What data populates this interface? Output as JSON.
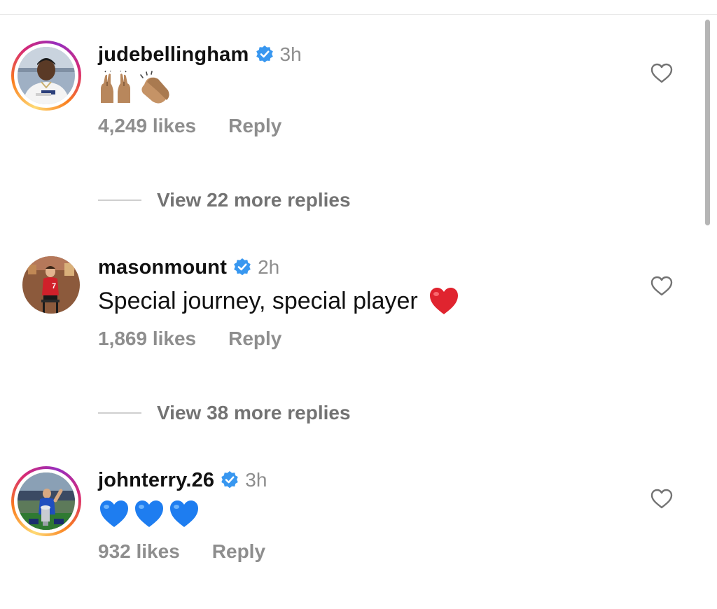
{
  "comments": [
    {
      "username": "judebellingham",
      "verified": true,
      "time": "3h",
      "text": "🙌🏽👏🏽",
      "text_icons": [
        "raising-hands-icon",
        "clapping-hands-icon"
      ],
      "likes": "4,249 likes",
      "reply_label": "Reply",
      "avatar_story_ring": true
    },
    {
      "username": "masonmount",
      "verified": true,
      "time": "2h",
      "text": "Special journey, special player",
      "text_icons": [
        "red-heart-icon"
      ],
      "likes": "1,869 likes",
      "reply_label": "Reply",
      "avatar_story_ring": false
    },
    {
      "username": "johnterry.26",
      "verified": true,
      "time": "3h",
      "text": "💙💙💙",
      "text_icons": [
        "blue-heart-icon",
        "blue-heart-icon",
        "blue-heart-icon"
      ],
      "likes": "932 likes",
      "reply_label": "Reply",
      "avatar_story_ring": true
    }
  ],
  "view_replies": [
    {
      "label": "View 22 more replies"
    },
    {
      "label": "View 38 more replies"
    }
  ],
  "colors": {
    "verified_blue": "#3897f0",
    "muted_text": "#8e8e8e",
    "red_heart": "#e0242f",
    "blue_heart": "#1e7df0"
  }
}
